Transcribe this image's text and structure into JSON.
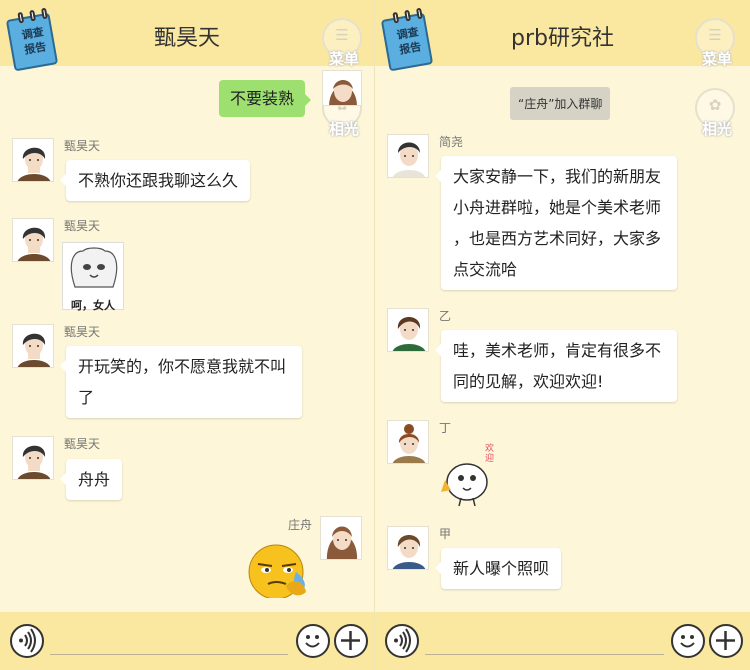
{
  "left_chat": {
    "title": "甄昊天",
    "report_badge": [
      "调查",
      "报告"
    ],
    "menu_caption": "菜单",
    "photo_caption": "相光",
    "outgoing_text": "不要装熟",
    "messages": [
      {
        "sender": "甄昊天",
        "text": "不熟你还跟我聊这么久"
      },
      {
        "sender": "甄昊天",
        "sticker_caption": "呵，女人"
      },
      {
        "sender": "甄昊天",
        "text_lines": [
          "开玩笑的，你不愿意我就不叫",
          "了"
        ]
      },
      {
        "sender": "甄昊天",
        "text": "舟舟"
      }
    ],
    "self_name": "庄舟"
  },
  "right_chat": {
    "title": "prb研究社",
    "report_badge": [
      "调查",
      "报告"
    ],
    "menu_caption": "菜单",
    "photo_caption": "相光",
    "system_note": "“庄舟”加入群聊",
    "messages": [
      {
        "sender": "简尧",
        "text_lines": [
          "大家安静一下，我们的新朋友",
          "小舟进群啦，她是个美术老师",
          "，也是西方艺术同好，大家多",
          "点交流哈"
        ]
      },
      {
        "sender": "乙",
        "text_lines": [
          "哇，美术老师，肯定有很多不",
          "同的见解，欢迎欢迎!"
        ]
      },
      {
        "sender": "丁",
        "sticker_caption": "欢迎"
      },
      {
        "sender": "甲",
        "text": "新人曝个照呗"
      }
    ]
  },
  "icons": [
    "menu-icon",
    "photo-icon",
    "voice-icon",
    "emoji-icon",
    "plus-icon"
  ],
  "colors": {
    "header": "#fbe8a0",
    "background": "#fdf6d8",
    "outgoing_bubble": "#9de070"
  }
}
